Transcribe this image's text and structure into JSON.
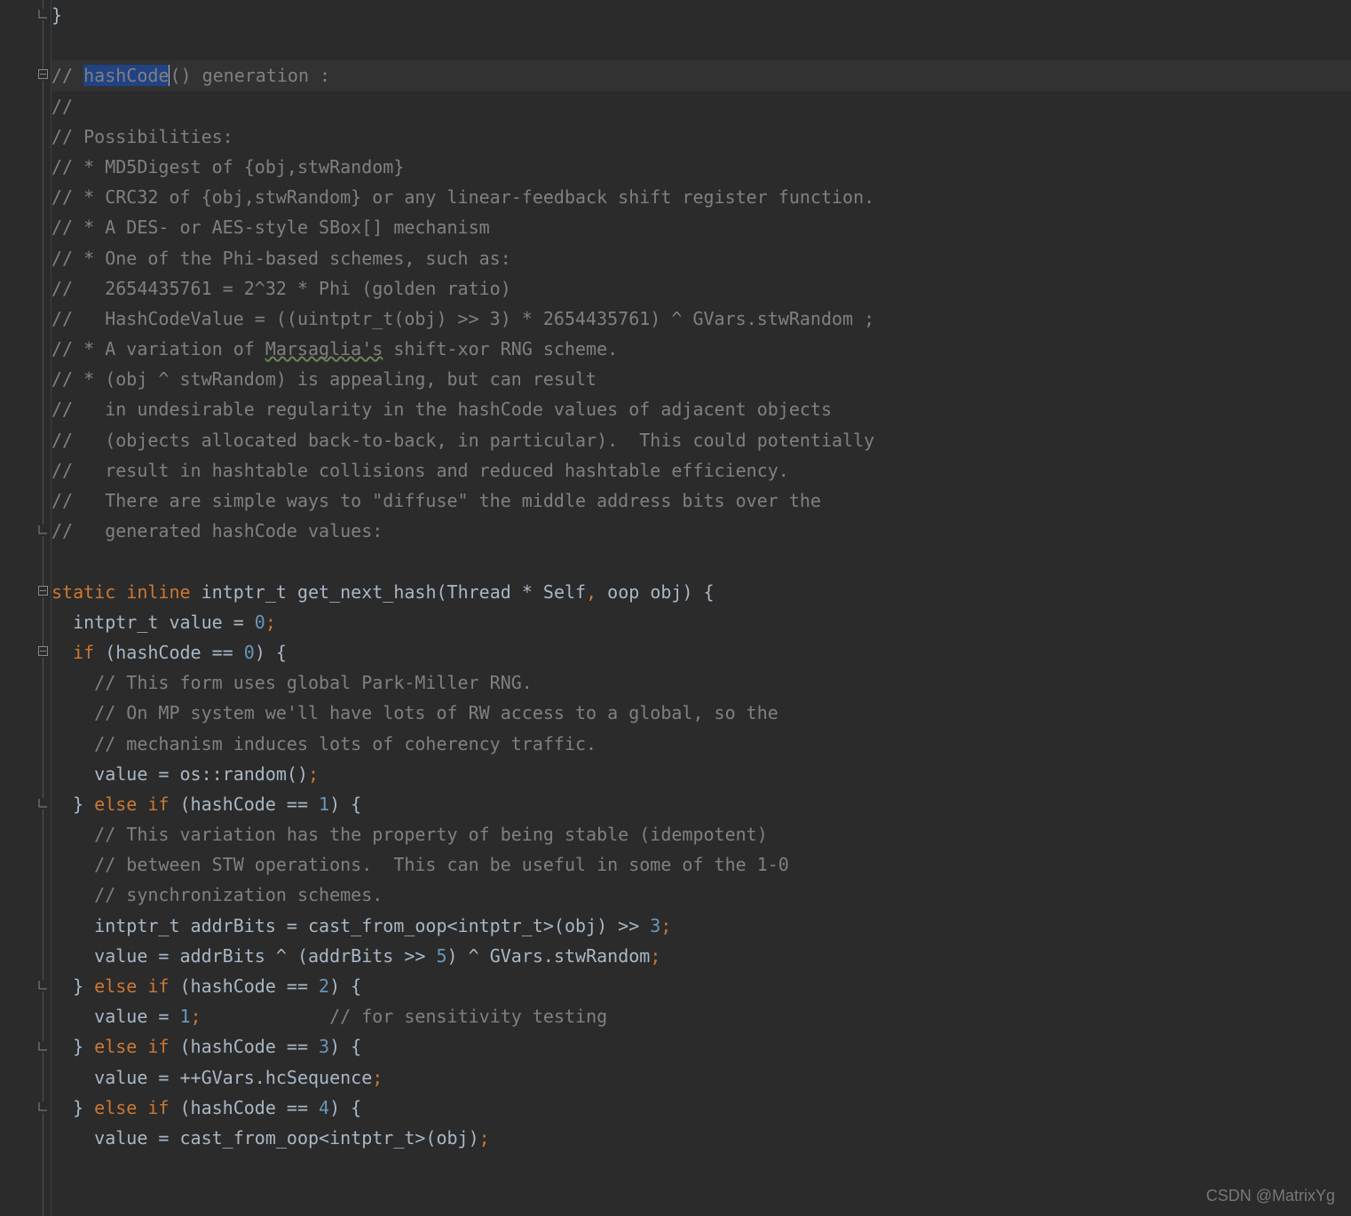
{
  "watermark": "CSDN @MatrixYg",
  "highlight_word": "hashCode",
  "code": {
    "lines": [
      {
        "tokens": [
          {
            "t": "}",
            "c": "op"
          }
        ]
      },
      {
        "tokens": []
      },
      {
        "hl": true,
        "tokens": [
          {
            "t": "// ",
            "c": "comment"
          },
          {
            "t": "hashCode",
            "c": "comment sel"
          },
          {
            "t": "() generation :",
            "c": "comment"
          }
        ]
      },
      {
        "tokens": [
          {
            "t": "//",
            "c": "comment"
          }
        ]
      },
      {
        "tokens": [
          {
            "t": "// Possibilities:",
            "c": "comment"
          }
        ]
      },
      {
        "tokens": [
          {
            "t": "// * MD5Digest of {obj,stwRandom}",
            "c": "comment"
          }
        ]
      },
      {
        "tokens": [
          {
            "t": "// * CRC32 of {obj,stwRandom} or any linear-feedback shift register function.",
            "c": "comment"
          }
        ]
      },
      {
        "tokens": [
          {
            "t": "// * A DES- or AES-style SBox[] mechanism",
            "c": "comment"
          }
        ]
      },
      {
        "tokens": [
          {
            "t": "// * One of the Phi-based schemes, such as:",
            "c": "comment"
          }
        ]
      },
      {
        "tokens": [
          {
            "t": "//   2654435761 = 2^32 * Phi (golden ratio)",
            "c": "comment"
          }
        ]
      },
      {
        "tokens": [
          {
            "t": "//   HashCodeValue = ((uintptr_t(obj) >> 3) * 2654435761) ^ GVars.stwRandom ;",
            "c": "comment"
          }
        ]
      },
      {
        "tokens": [
          {
            "t": "// * A variation of ",
            "c": "comment"
          },
          {
            "t": "Marsaglia's",
            "c": "comment squiggle"
          },
          {
            "t": " shift-xor RNG scheme.",
            "c": "comment"
          }
        ]
      },
      {
        "tokens": [
          {
            "t": "// * (obj ^ stwRandom) is appealing, but can result",
            "c": "comment"
          }
        ]
      },
      {
        "tokens": [
          {
            "t": "//   in undesirable regularity in the hashCode values of adjacent objects",
            "c": "comment"
          }
        ]
      },
      {
        "tokens": [
          {
            "t": "//   (objects allocated back-to-back, in particular).  This could potentially",
            "c": "comment"
          }
        ]
      },
      {
        "tokens": [
          {
            "t": "//   result in hashtable collisions and reduced hashtable efficiency.",
            "c": "comment"
          }
        ]
      },
      {
        "tokens": [
          {
            "t": "//   There are simple ways to \"diffuse\" the middle address bits over the",
            "c": "comment"
          }
        ]
      },
      {
        "tokens": [
          {
            "t": "//   generated hashCode values:",
            "c": "comment"
          }
        ]
      },
      {
        "tokens": []
      },
      {
        "tokens": [
          {
            "t": "static inline",
            "c": "kw"
          },
          {
            "t": " intptr_t ",
            "c": "type"
          },
          {
            "t": "get_next_hash",
            "c": "fn"
          },
          {
            "t": "(Thread * Self",
            "c": "type"
          },
          {
            "t": ",",
            "c": "kw"
          },
          {
            "t": " oop obj) {",
            "c": "type"
          }
        ]
      },
      {
        "tokens": [
          {
            "t": "  intptr_t value = ",
            "c": "type"
          },
          {
            "t": "0",
            "c": "num"
          },
          {
            "t": ";",
            "c": "kw"
          }
        ]
      },
      {
        "tokens": [
          {
            "t": "  ",
            "c": "op"
          },
          {
            "t": "if",
            "c": "kw"
          },
          {
            "t": " (hashCode == ",
            "c": "type"
          },
          {
            "t": "0",
            "c": "num"
          },
          {
            "t": ") {",
            "c": "type"
          }
        ]
      },
      {
        "tokens": [
          {
            "t": "    // This form uses global Park-Miller RNG.",
            "c": "comment"
          }
        ]
      },
      {
        "tokens": [
          {
            "t": "    // On MP system we'll have lots of RW access to a global, so the",
            "c": "comment"
          }
        ]
      },
      {
        "tokens": [
          {
            "t": "    // mechanism induces lots of coherency traffic.",
            "c": "comment"
          }
        ]
      },
      {
        "tokens": [
          {
            "t": "    value = os::random()",
            "c": "type"
          },
          {
            "t": ";",
            "c": "kw"
          }
        ]
      },
      {
        "tokens": [
          {
            "t": "  } ",
            "c": "type"
          },
          {
            "t": "else if",
            "c": "kw"
          },
          {
            "t": " (hashCode == ",
            "c": "type"
          },
          {
            "t": "1",
            "c": "num"
          },
          {
            "t": ") {",
            "c": "type"
          }
        ]
      },
      {
        "tokens": [
          {
            "t": "    // This variation has the property of being stable (idempotent)",
            "c": "comment"
          }
        ]
      },
      {
        "tokens": [
          {
            "t": "    // between STW operations.  This can be useful in some of the 1-0",
            "c": "comment"
          }
        ]
      },
      {
        "tokens": [
          {
            "t": "    // synchronization schemes.",
            "c": "comment"
          }
        ]
      },
      {
        "tokens": [
          {
            "t": "    intptr_t addrBits = cast_from_oop<intptr_t>(obj) >> ",
            "c": "type"
          },
          {
            "t": "3",
            "c": "num"
          },
          {
            "t": ";",
            "c": "kw"
          }
        ]
      },
      {
        "tokens": [
          {
            "t": "    value = addrBits ^ (addrBits >> ",
            "c": "type"
          },
          {
            "t": "5",
            "c": "num"
          },
          {
            "t": ") ^ GVars.stwRandom",
            "c": "type"
          },
          {
            "t": ";",
            "c": "kw"
          }
        ]
      },
      {
        "tokens": [
          {
            "t": "  } ",
            "c": "type"
          },
          {
            "t": "else if",
            "c": "kw"
          },
          {
            "t": " (hashCode == ",
            "c": "type"
          },
          {
            "t": "2",
            "c": "num"
          },
          {
            "t": ") {",
            "c": "type"
          }
        ]
      },
      {
        "tokens": [
          {
            "t": "    value = ",
            "c": "type"
          },
          {
            "t": "1",
            "c": "num"
          },
          {
            "t": ";            ",
            "c": "kw"
          },
          {
            "t": "// for sensitivity testing",
            "c": "comment"
          }
        ]
      },
      {
        "tokens": [
          {
            "t": "  } ",
            "c": "type"
          },
          {
            "t": "else if",
            "c": "kw"
          },
          {
            "t": " (hashCode == ",
            "c": "type"
          },
          {
            "t": "3",
            "c": "num"
          },
          {
            "t": ") {",
            "c": "type"
          }
        ]
      },
      {
        "tokens": [
          {
            "t": "    value = ++GVars.hcSequence",
            "c": "type"
          },
          {
            "t": ";",
            "c": "kw"
          }
        ]
      },
      {
        "tokens": [
          {
            "t": "  } ",
            "c": "type"
          },
          {
            "t": "else if",
            "c": "kw"
          },
          {
            "t": " (hashCode == ",
            "c": "type"
          },
          {
            "t": "4",
            "c": "num"
          },
          {
            "t": ") {",
            "c": "type"
          }
        ]
      },
      {
        "tokens": [
          {
            "t": "    value = cast_from_oop<intptr_t>(obj)",
            "c": "type"
          },
          {
            "t": ";",
            "c": "kw"
          }
        ]
      }
    ]
  },
  "fold_markers": [
    {
      "line": 0,
      "type": "close"
    },
    {
      "line": 2,
      "type": "open"
    },
    {
      "line": 17,
      "type": "close"
    },
    {
      "line": 19,
      "type": "open"
    },
    {
      "line": 21,
      "type": "open"
    },
    {
      "line": 26,
      "type": "close"
    },
    {
      "line": 32,
      "type": "close"
    },
    {
      "line": 34,
      "type": "close"
    },
    {
      "line": 36,
      "type": "close"
    }
  ]
}
